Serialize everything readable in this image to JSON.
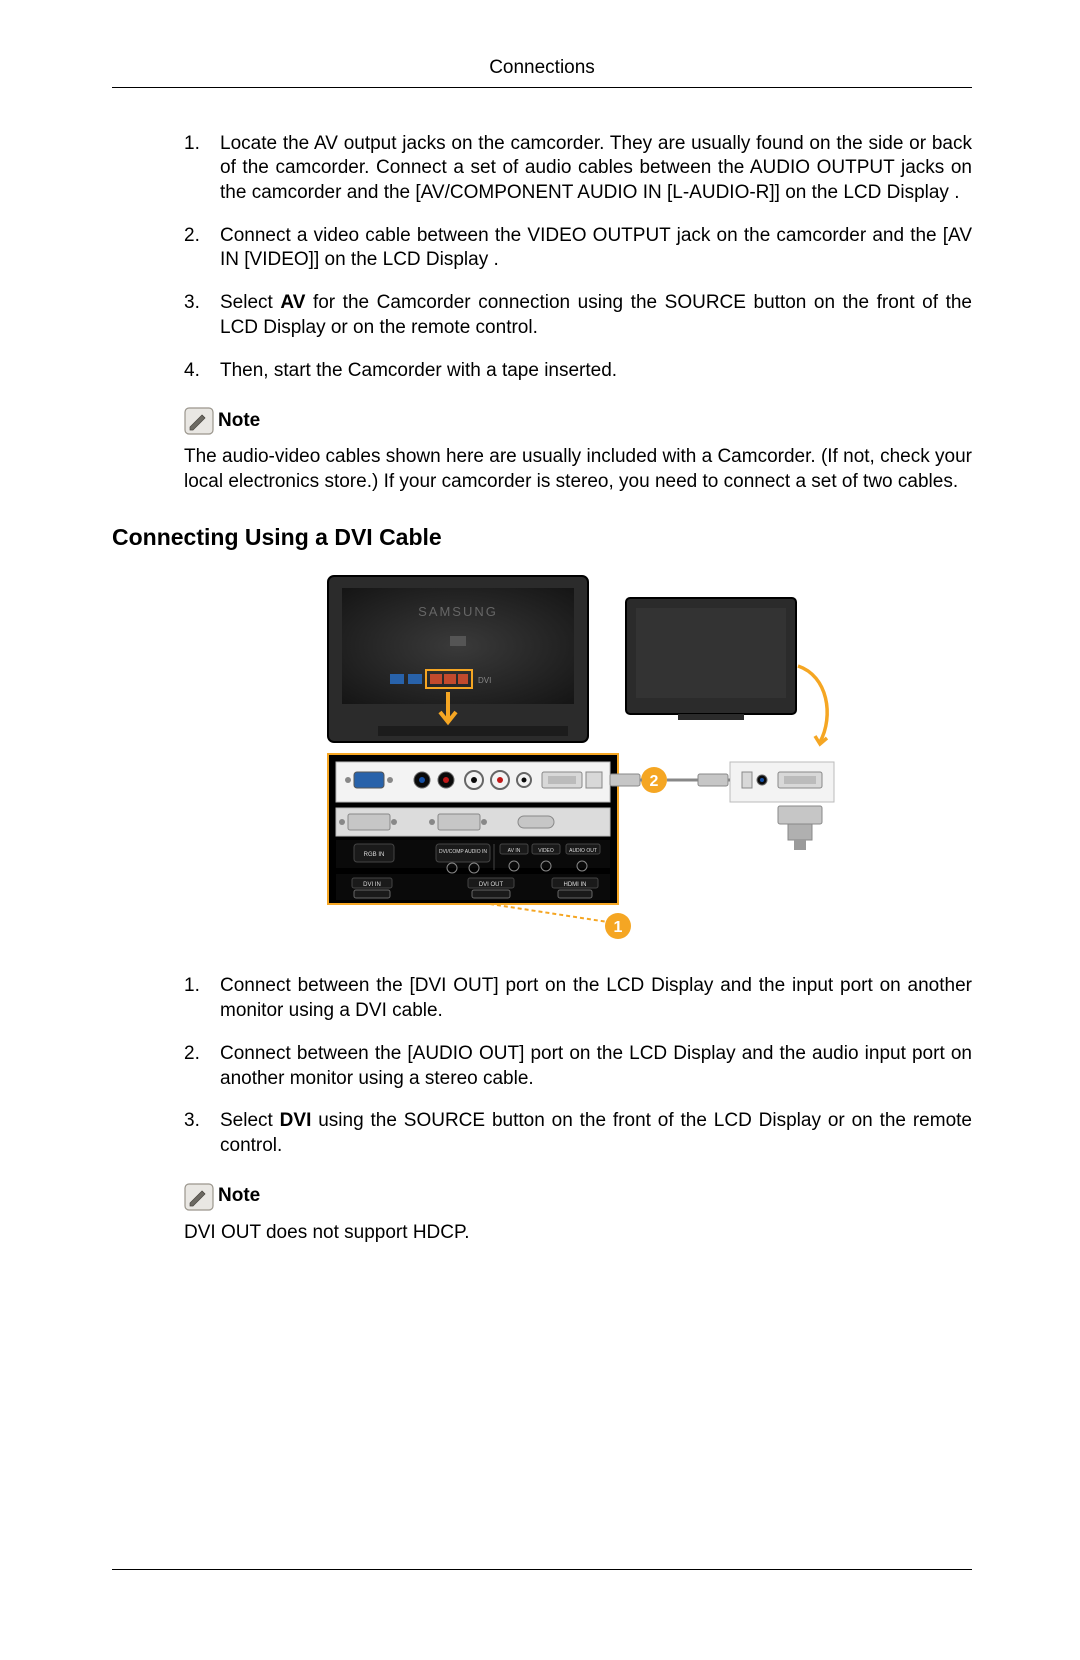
{
  "header": {
    "title": "Connections"
  },
  "section1": {
    "steps": [
      {
        "num": "1.",
        "text": "Locate the AV output jacks on the camcorder. They are usually found on the side or back of the camcorder. Connect a set of audio cables between the AUDIO OUTPUT jacks on the camcorder and the [AV/COMPONENT AUDIO IN [L-AUDIO-R]] on the LCD Display ."
      },
      {
        "num": "2.",
        "text": "Connect a video cable between the VIDEO OUTPUT jack on the camcorder and the [AV IN [VIDEO]] on the LCD Display ."
      },
      {
        "num": "3.",
        "before": "Select ",
        "bold": "AV",
        "after": " for the Camcorder connection using the SOURCE button on the front of the LCD Display or on the remote control."
      },
      {
        "num": "4.",
        "text": "Then, start the Camcorder with a tape inserted."
      }
    ],
    "note_label": "Note",
    "note_text": "The audio-video cables shown here are usually included with a Camcorder. (If not, check your local electronics store.) If your camcorder is stereo, you need to connect a set of two cables."
  },
  "section2": {
    "heading": "Connecting Using a DVI Cable",
    "steps": [
      {
        "num": "1.",
        "text": "Connect between the [DVI OUT] port on the LCD Display and the input port on another monitor using a DVI cable."
      },
      {
        "num": "2.",
        "text": "Connect between the [AUDIO OUT] port on the LCD Display and the audio input port on another monitor using a stereo cable."
      },
      {
        "num": "3.",
        "before": "Select ",
        "bold": "DVI",
        "after": " using the SOURCE button on the front of the LCD Display or on the remote control."
      }
    ],
    "note_label": "Note",
    "note_text": "DVI OUT does not support HDCP."
  },
  "icons": {
    "note_icon": "pencil-note-icon"
  },
  "diagram": {
    "brand_text": "SAMSUNG",
    "callout1": "1",
    "callout2": "2",
    "port_labels": {
      "rgb_in": "RGB IN",
      "dvi_in": "DVI IN",
      "dvi_out": "DVI OUT",
      "hdmi_in": "HDMI IN",
      "av_in": "AV IN",
      "video": "VIDEO",
      "audio_out": "AUDIO OUT",
      "comp_audio": "DVI/COMP AUDIO IN"
    }
  }
}
